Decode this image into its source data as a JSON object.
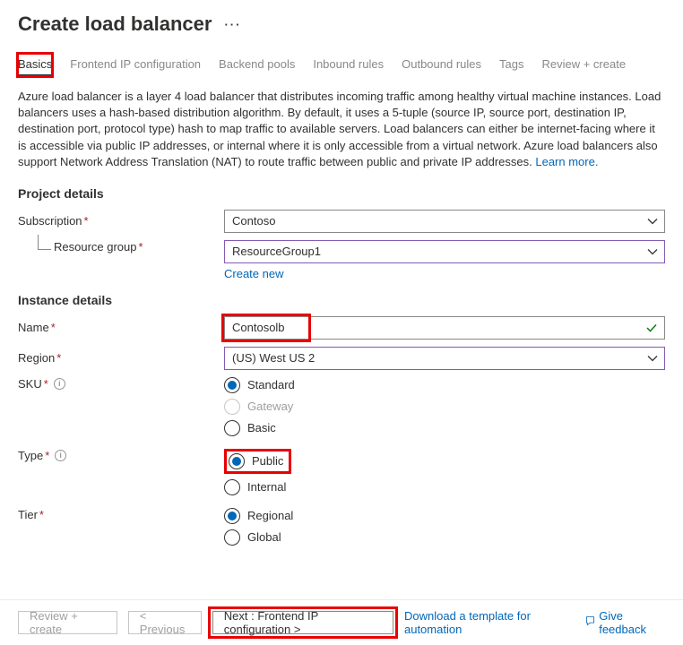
{
  "header": {
    "title": "Create load balancer"
  },
  "tabs": [
    {
      "label": "Basics",
      "active": true
    },
    {
      "label": "Frontend IP configuration"
    },
    {
      "label": "Backend pools"
    },
    {
      "label": "Inbound rules"
    },
    {
      "label": "Outbound rules"
    },
    {
      "label": "Tags"
    },
    {
      "label": "Review + create"
    }
  ],
  "description": {
    "text": "Azure load balancer is a layer 4 load balancer that distributes incoming traffic among healthy virtual machine instances. Load balancers uses a hash-based distribution algorithm. By default, it uses a 5-tuple (source IP, source port, destination IP, destination port, protocol type) hash to map traffic to available servers. Load balancers can either be internet-facing where it is accessible via public IP addresses, or internal where it is only accessible from a virtual network. Azure load balancers also support Network Address Translation (NAT) to route traffic between public and private IP addresses.  ",
    "link": "Learn more."
  },
  "sections": {
    "project": "Project details",
    "instance": "Instance details"
  },
  "fields": {
    "subscription": {
      "label": "Subscription",
      "value": "Contoso"
    },
    "resourceGroup": {
      "label": "Resource group",
      "value": "ResourceGroup1",
      "createNew": "Create new"
    },
    "name": {
      "label": "Name",
      "value": "Contosolb"
    },
    "region": {
      "label": "Region",
      "value": "(US) West US 2"
    },
    "sku": {
      "label": "SKU",
      "options": {
        "standard": "Standard",
        "gateway": "Gateway",
        "basic": "Basic"
      },
      "selected": "standard",
      "disabled": "gateway"
    },
    "type": {
      "label": "Type",
      "options": {
        "public": "Public",
        "internal": "Internal"
      },
      "selected": "public"
    },
    "tier": {
      "label": "Tier",
      "options": {
        "regional": "Regional",
        "global": "Global"
      },
      "selected": "regional"
    }
  },
  "footer": {
    "reviewCreate": "Review + create",
    "previous": "< Previous",
    "next": "Next : Frontend IP configuration >",
    "downloadTemplate": "Download a template for automation",
    "feedback": "Give feedback"
  }
}
